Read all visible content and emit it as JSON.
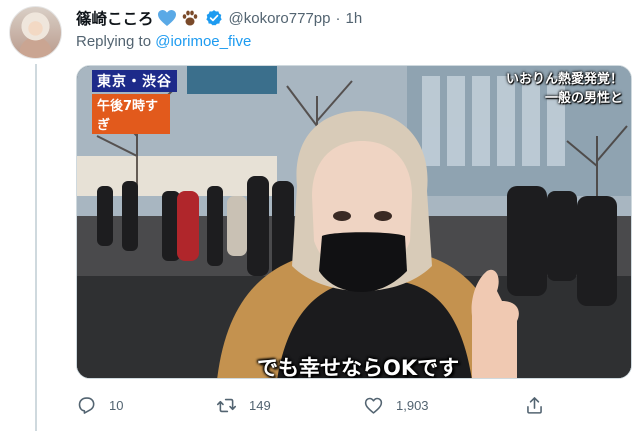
{
  "author": {
    "display_name": "篠崎こころ",
    "handle": "@kokoro777pp",
    "separator": "·",
    "time": "1h"
  },
  "reply": {
    "prefix": "Replying to ",
    "handle": "@iorimoe_five"
  },
  "media": {
    "location": "東京・渋谷",
    "time_caption": "午後7時すぎ",
    "top_caption_line1": "いおりん熱愛発覚！",
    "top_caption_line2": "一般の男性と",
    "subtitle": "でも幸せならOKです"
  },
  "actions": {
    "reply_count": "10",
    "retweet_count": "149",
    "like_count": "1,903"
  },
  "colors": {
    "link": "#1d9bf0",
    "secondary_text": "#536471",
    "heart": "#5aa9e6",
    "verified": "#1d9bf0"
  }
}
